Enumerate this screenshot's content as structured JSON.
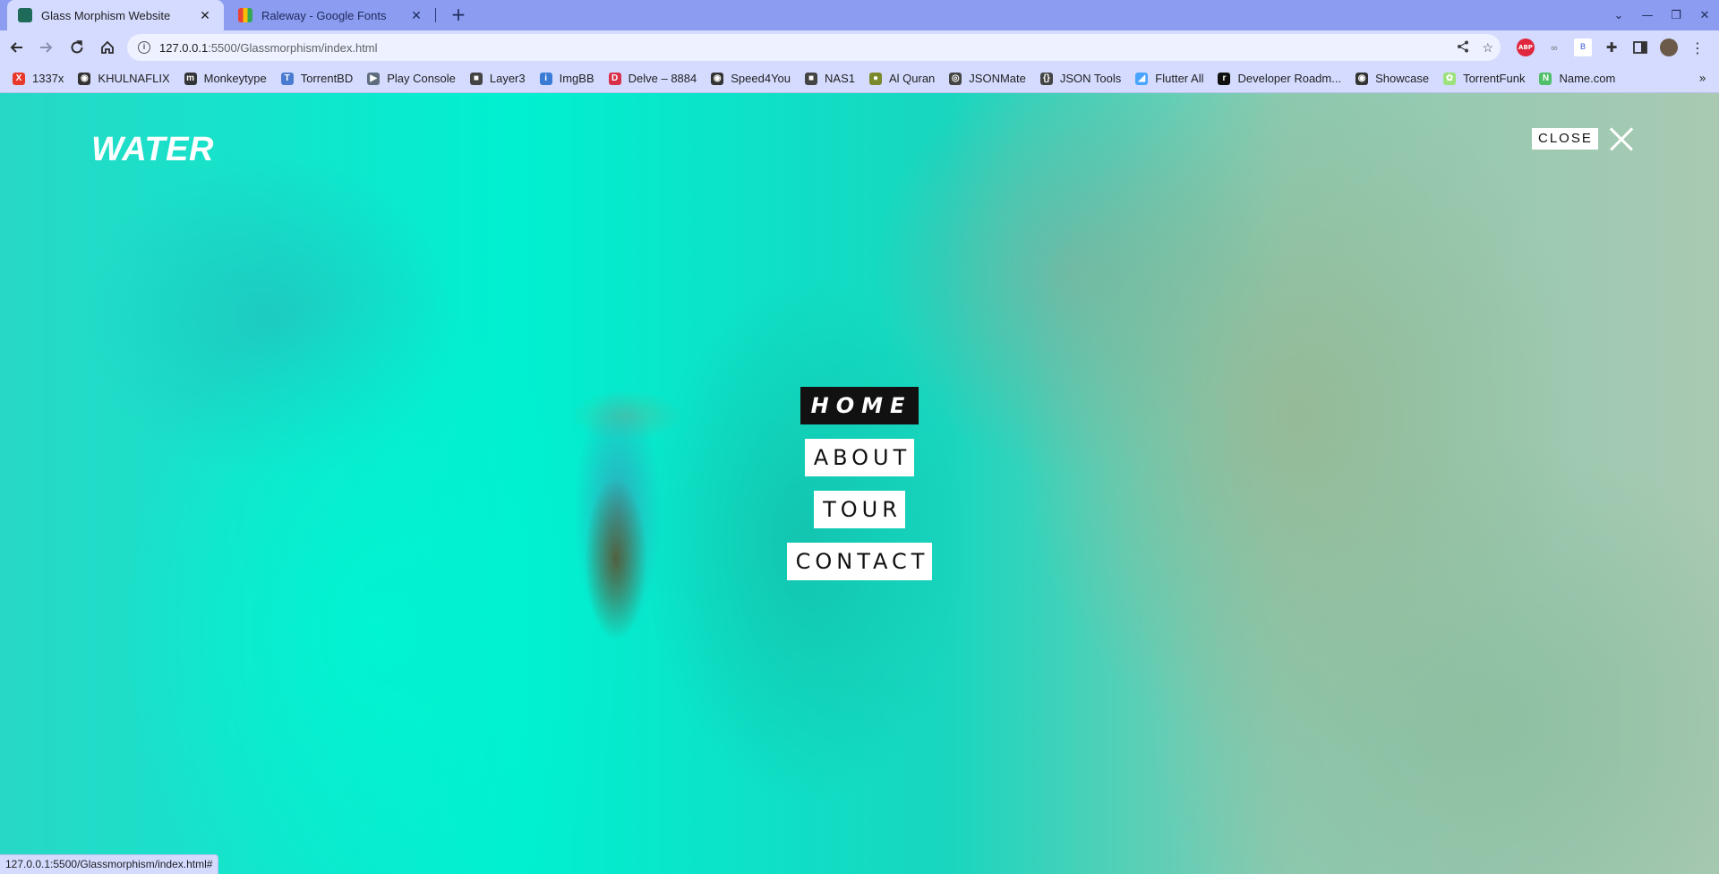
{
  "browser": {
    "tabs": [
      {
        "title": "Glass Morphism Website",
        "close": "✕",
        "favicon_color": "#1d6b58",
        "active": true
      },
      {
        "title": "Raleway - Google Fonts",
        "close": "✕",
        "favicon_color": "#ea4335",
        "active": false
      }
    ],
    "new_tab": "+",
    "window_controls": {
      "tab_search": "⌄",
      "minimize": "—",
      "restore": "❐",
      "close": "✕"
    },
    "url_host": "127.0.0.1",
    "url_rest": ":5500/Glassmorphism/index.html",
    "bookmarks": [
      {
        "label": "1337x",
        "icon": "x-icon",
        "color": "#e8382b",
        "glyph": "X"
      },
      {
        "label": "KHULNAFLIX",
        "icon": "globe-icon",
        "color": "#333333",
        "glyph": "◉"
      },
      {
        "label": "Monkeytype",
        "icon": "monkeytype-icon",
        "color": "#323437",
        "glyph": "m"
      },
      {
        "label": "TorrentBD",
        "icon": "torrentbd-icon",
        "color": "#4a7bd0",
        "glyph": "T"
      },
      {
        "label": "Play Console",
        "icon": "play-icon",
        "color": "#5f6c80",
        "glyph": "▶"
      },
      {
        "label": "Layer3",
        "icon": "folder-icon",
        "color": "#444444",
        "glyph": "■"
      },
      {
        "label": "ImgBB",
        "icon": "imgbb-icon",
        "color": "#3a7bd5",
        "glyph": "i"
      },
      {
        "label": "Delve – 8884",
        "icon": "delve-icon",
        "color": "#d9304a",
        "glyph": "D"
      },
      {
        "label": "Speed4You",
        "icon": "globe-icon",
        "color": "#333333",
        "glyph": "◉"
      },
      {
        "label": "NAS1",
        "icon": "folder-icon",
        "color": "#444444",
        "glyph": "■"
      },
      {
        "label": "Al Quran",
        "icon": "alquran-icon",
        "color": "#7a8a2a",
        "glyph": "●"
      },
      {
        "label": "JSONMate",
        "icon": "jsonmate-icon",
        "color": "#444444",
        "glyph": "◎"
      },
      {
        "label": "JSON Tools",
        "icon": "json-tools-icon",
        "color": "#444444",
        "glyph": "{}"
      },
      {
        "label": "Flutter All",
        "icon": "flutter-icon",
        "color": "#4aa3ff",
        "glyph": "◢"
      },
      {
        "label": "Developer Roadm...",
        "icon": "roadmap-icon",
        "color": "#111111",
        "glyph": "r"
      },
      {
        "label": "Showcase",
        "icon": "globe-icon",
        "color": "#333333",
        "glyph": "◉"
      },
      {
        "label": "TorrentFunk",
        "icon": "torrentfunk-icon",
        "color": "#9be27a",
        "glyph": "✿"
      },
      {
        "label": "Name.com",
        "icon": "namecom-icon",
        "color": "#4fbf6a",
        "glyph": "N"
      }
    ],
    "bookmarks_more": "»",
    "status_url": "127.0.0.1:5500/Glassmorphism/index.html#"
  },
  "page": {
    "brand": "WATER",
    "close_label": "CLOSE",
    "menu": [
      {
        "label": "HOME",
        "active": true
      },
      {
        "label": "ABOUT",
        "active": false
      },
      {
        "label": "TOUR",
        "active": false
      },
      {
        "label": "CONTACT",
        "active": false
      }
    ]
  }
}
